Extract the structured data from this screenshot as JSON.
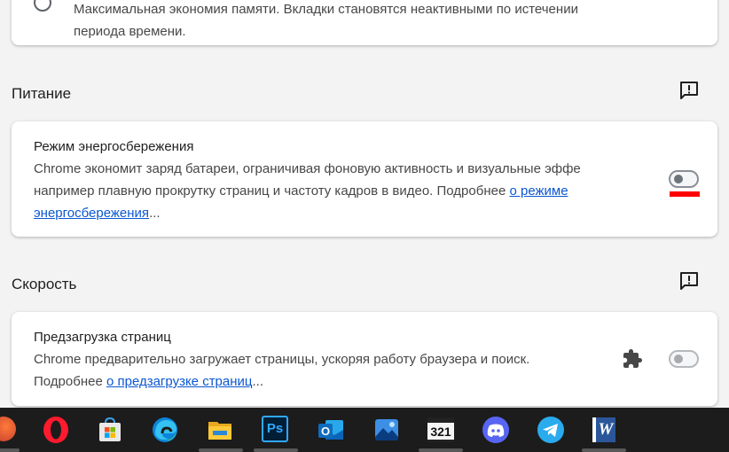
{
  "memory_option": {
    "text_line1": "Максимальная экономия памяти. Вкладки становятся неактивными по истечении",
    "text_line2": "периода времени."
  },
  "power": {
    "section_title": "Питание",
    "energy_saver": {
      "title": "Режим энергосбережения",
      "line1": "Chrome экономит заряд батареи, ограничивая фоновую активность и визуальные эффе",
      "line2_text": "например плавную прокрутку страниц и частоту кадров в видео. Подробнее ",
      "link_part1": "о режиме",
      "link_part2": "энергосбережения",
      "ellipsis": "..."
    }
  },
  "speed": {
    "section_title": "Скорость",
    "preload": {
      "title": "Предзагрузка страниц",
      "line1": "Chrome предварительно загружает страницы, ускоряя работу браузера и поиск.",
      "line2_text": "Подробнее ",
      "link": "о предзагрузке страниц",
      "ellipsis": "..."
    }
  },
  "icons": {
    "feedback": "feedback-icon",
    "extension": "puzzle-icon"
  },
  "taskbar": {
    "apps": [
      "vpn",
      "opera",
      "microsoft-store",
      "edge",
      "file-explorer",
      "photoshop",
      "outlook",
      "photos",
      "media-player-classic",
      "discord",
      "telegram",
      "word"
    ],
    "photoshop_label": "Ps",
    "outlook_label": "O",
    "word_label": "W",
    "mpc_label": "321"
  },
  "colors": {
    "link": "#0b57d0",
    "highlight": "#ff0000",
    "taskbar": "#1c1c1c"
  }
}
